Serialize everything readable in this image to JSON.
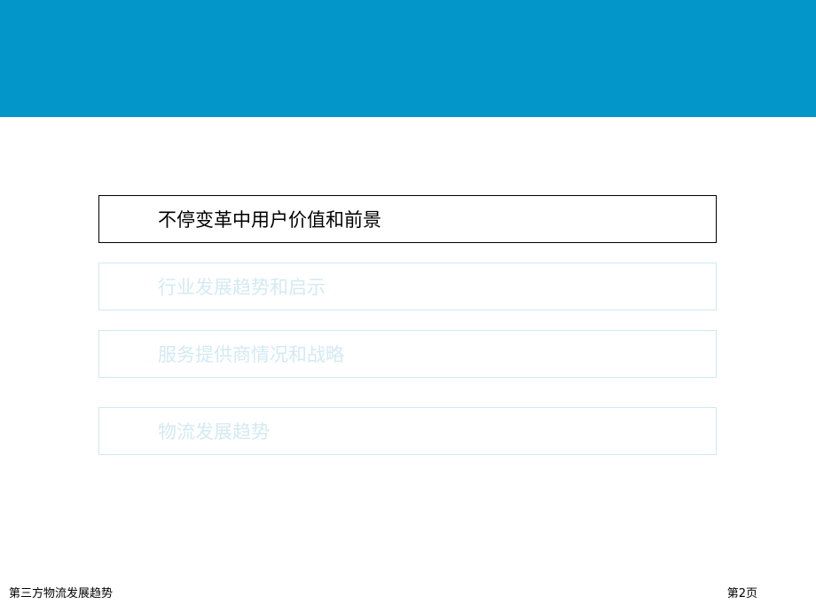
{
  "slide": {
    "agenda": [
      {
        "label": "不停变革中用户价值和前景",
        "active": true
      },
      {
        "label": "行业发展趋势和启示",
        "active": false
      },
      {
        "label": "服务提供商情况和战略",
        "active": false
      },
      {
        "label": "物流发展趋势",
        "active": false
      }
    ]
  },
  "footer": {
    "title": "第三方物流发展趋势",
    "page": "第2页"
  },
  "colors": {
    "header_band": "#0396c8",
    "active_border": "#000000",
    "inactive_border": "#cde9f5",
    "inactive_text": "#d3eaf4"
  }
}
